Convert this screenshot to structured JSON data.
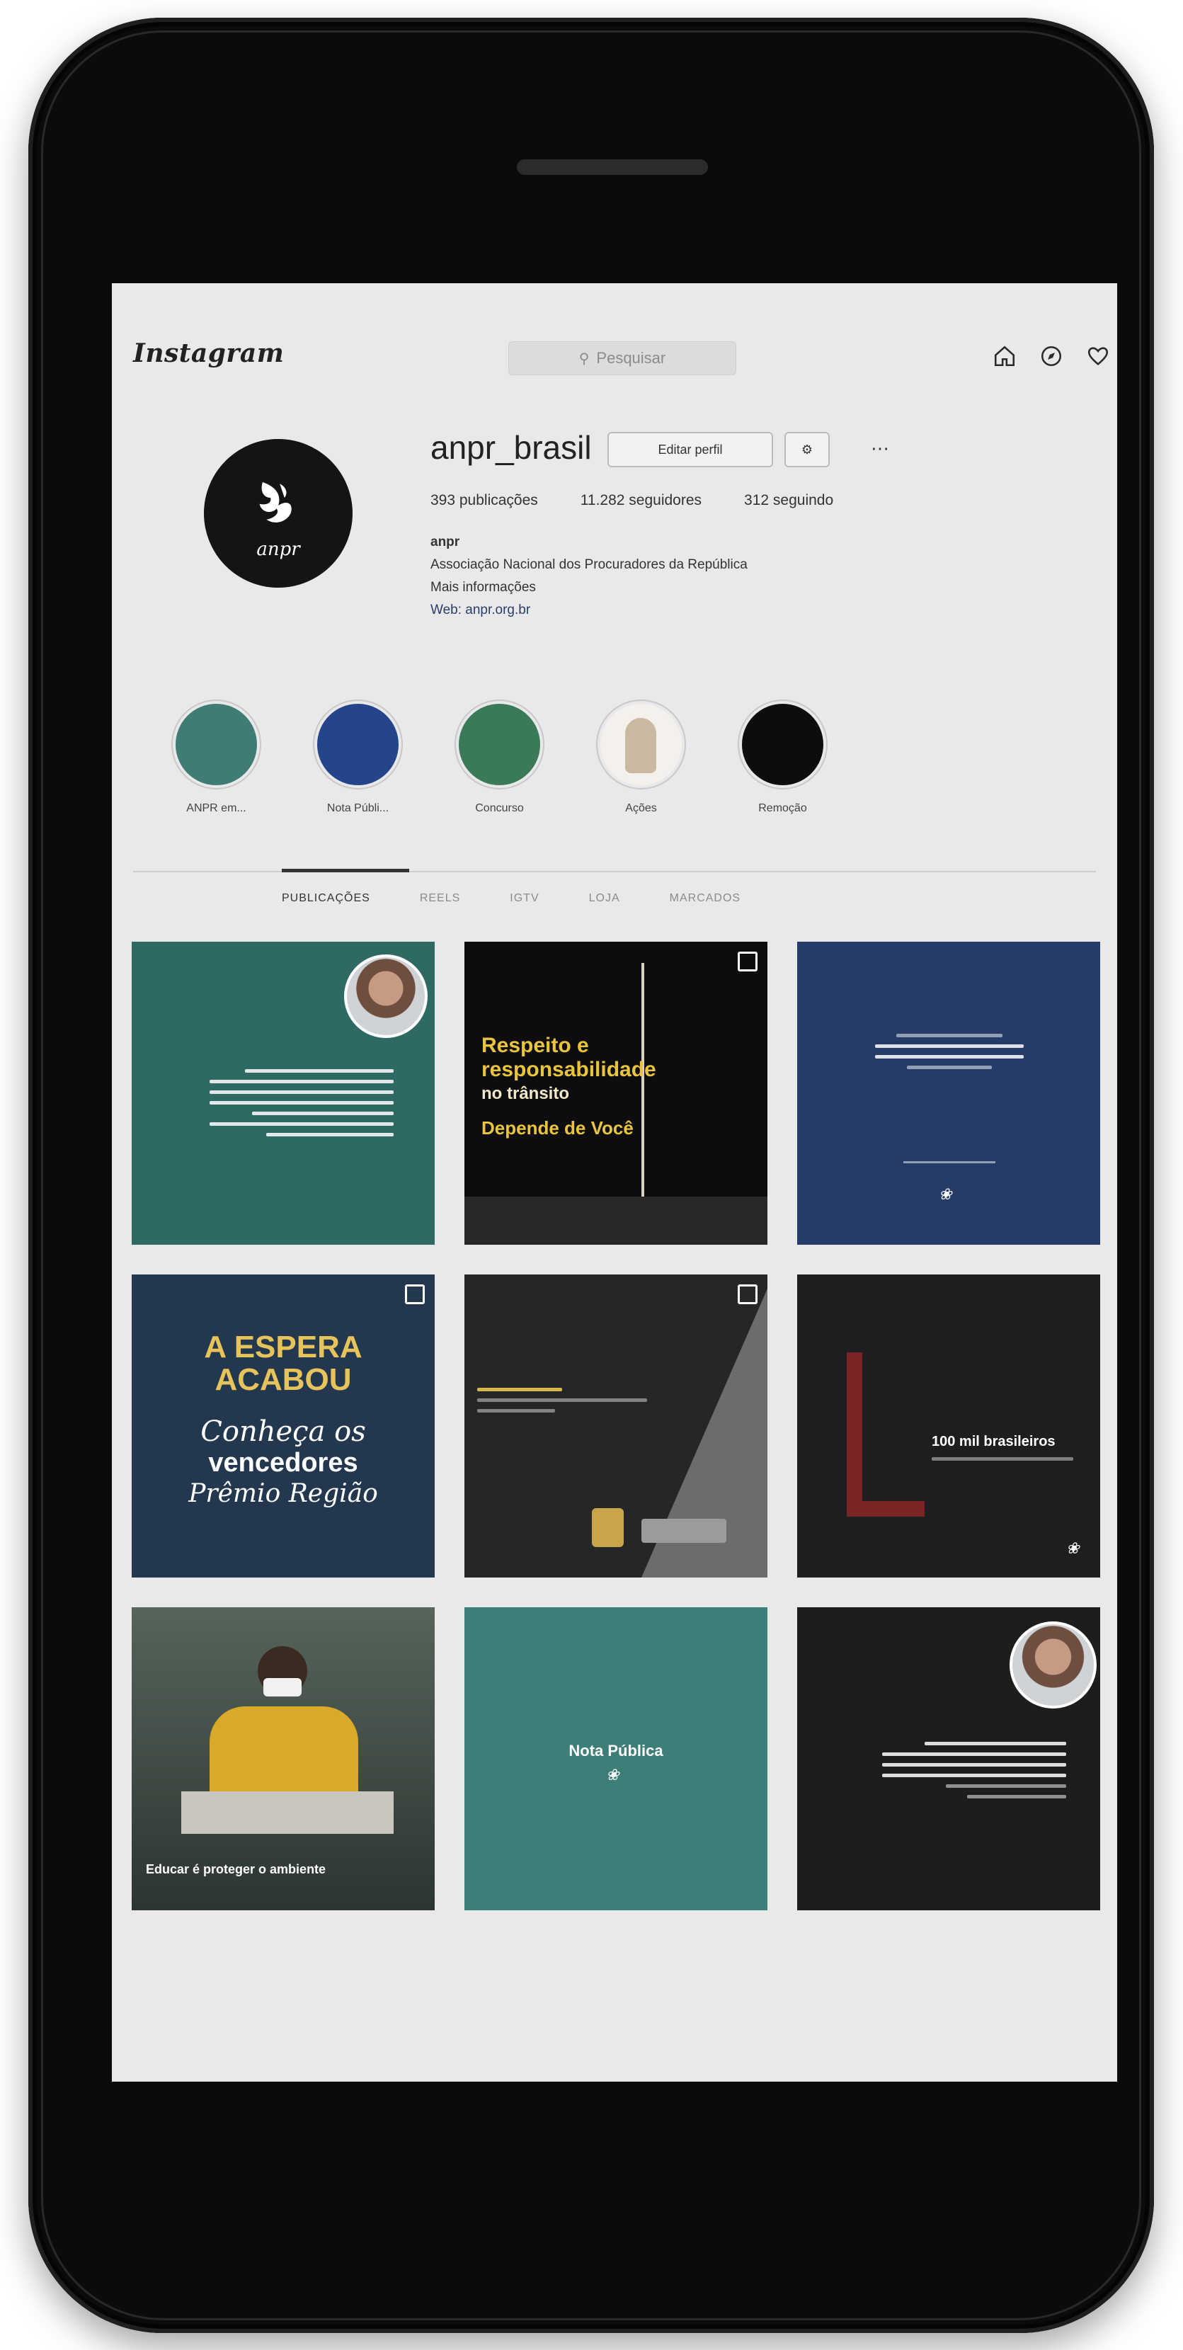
{
  "app": {
    "logo_text": "Instagram",
    "search_placeholder": "Pesquisar"
  },
  "nav_icons": [
    "home-icon",
    "explore-icon",
    "heart-icon"
  ],
  "profile": {
    "username": "anpr_brasil",
    "edit_button": "Editar perfil",
    "posts": "393 publicações",
    "followers": "11.282 seguidores",
    "following": "312 seguindo",
    "name": "anpr",
    "bio_line1": "Associação Nacional dos Procuradores da República",
    "bio_line2": "Mais informações",
    "bio_link": "Web: anpr.org.br"
  },
  "highlights": [
    {
      "label": "ANPR em...",
      "color": "#3f7d74"
    },
    {
      "label": "Nota Públi...",
      "color": "#25458b"
    },
    {
      "label": "Concurso",
      "color": "#3b7a56"
    },
    {
      "label": "Ações",
      "color": "#f4f1ec"
    },
    {
      "label": "Remoção",
      "color": "#0d0d0d"
    }
  ],
  "tabs": [
    "PUBLICAÇÕES",
    "REELS",
    "IGTV",
    "LOJA",
    "MARCADOS"
  ],
  "posts": {
    "p2_line1": "Respeito e",
    "p2_line2": "responsabilidade",
    "p2_line3": "no trânsito",
    "p2_line4": "Depende de Você",
    "p4_line1": "A ESPERA",
    "p4_line2": "ACABOU",
    "p4_line3": "Conheça os",
    "p4_line4": "vencedores",
    "p4_line5": "Prêmio Região",
    "p6_title": "100 mil brasileiros",
    "p7_caption": "Educar é proteger o ambiente",
    "p8_title": "Nota Pública"
  }
}
